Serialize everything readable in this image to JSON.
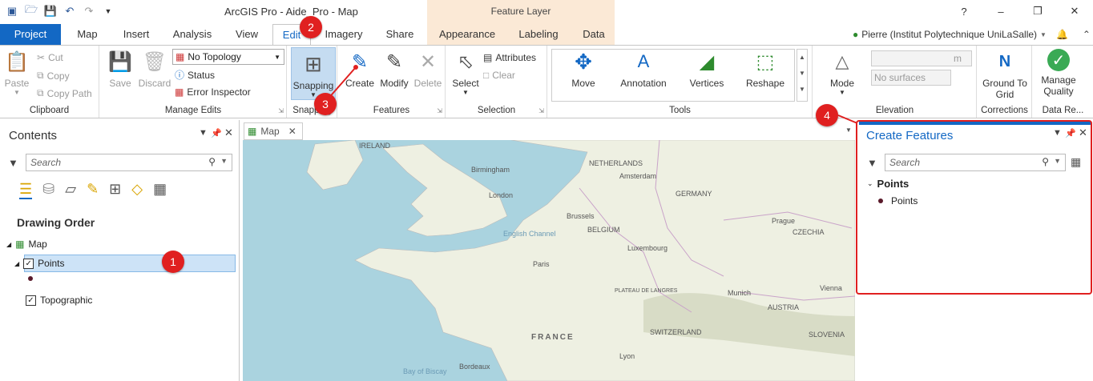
{
  "window": {
    "title": "ArcGIS Pro - Aide_Pro - Map",
    "context_group": "Feature Layer",
    "controls": [
      "?",
      "–",
      "❐",
      "✕"
    ]
  },
  "tabs": [
    {
      "label": "Project"
    },
    {
      "label": "Map"
    },
    {
      "label": "Insert"
    },
    {
      "label": "Analysis"
    },
    {
      "label": "View"
    },
    {
      "label": "Edit"
    },
    {
      "label": "Imagery"
    },
    {
      "label": "Share"
    },
    {
      "label": "Appearance"
    },
    {
      "label": "Labeling"
    },
    {
      "label": "Data"
    }
  ],
  "user": "Pierre (Institut Polytechnique UniLaSalle)",
  "ribbon": {
    "clipboard": {
      "label": "Clipboard",
      "paste": "Paste",
      "cut": "Cut",
      "copy": "Copy",
      "copy_path": "Copy Path"
    },
    "manage_edits": {
      "label": "Manage Edits",
      "save": "Save",
      "discard": "Discard",
      "topology": "No Topology",
      "status": "Status",
      "error_inspector": "Error Inspector"
    },
    "snapping": {
      "label": "Snapping",
      "button": "Snapping"
    },
    "features": {
      "label": "Features",
      "create": "Create",
      "modify": "Modify",
      "delete": "Delete"
    },
    "selection": {
      "label": "Selection",
      "select": "Select",
      "attributes": "Attributes",
      "clear": "Clear"
    },
    "tools": {
      "label": "Tools",
      "move": "Move",
      "annotation": "Annotation",
      "vertices": "Vertices",
      "reshape": "Reshape"
    },
    "elevation": {
      "label": "Elevation",
      "mode": "Mode",
      "unit": "m",
      "surface": "No surfaces"
    },
    "corrections": {
      "label": "Corrections",
      "ground_to_grid": "Ground To Grid"
    },
    "data_reviewer": {
      "label": "Data Re...",
      "manage_quality": "Manage Quality"
    }
  },
  "contents": {
    "title": "Contents",
    "search_placeholder": "Search",
    "section": "Drawing Order",
    "items": [
      {
        "label": "Map"
      },
      {
        "label": "Points"
      },
      {
        "label": "Topographic"
      }
    ]
  },
  "map": {
    "tab_label": "Map",
    "labels": [
      "IRELAND",
      "NETHERLANDS",
      "GERMANY",
      "BELGIUM",
      "FRANCE",
      "CZECHIA",
      "AUSTRIA",
      "SWITZERLAND",
      "SLOVENIA",
      "London",
      "Birmingham",
      "Amsterdam",
      "Brussels",
      "Luxembourg",
      "Paris",
      "Prague",
      "Munich",
      "Vienna",
      "Lyon",
      "Bordeaux",
      "PLATEAU DE LANGRES",
      "English Channel",
      "Bay of Biscay"
    ]
  },
  "create_features": {
    "title": "Create Features",
    "search_placeholder": "Search",
    "group": "Points",
    "item": "Points"
  },
  "annotations": [
    "1",
    "2",
    "3",
    "4"
  ],
  "colors": {
    "accent": "#1368c4",
    "highlight_red": "#e02020",
    "context_tab": "#fbe9d6"
  }
}
